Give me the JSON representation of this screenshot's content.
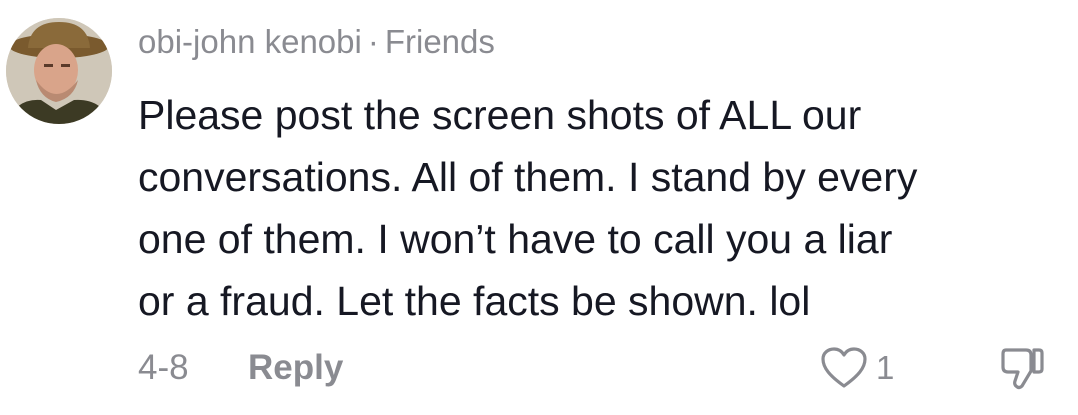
{
  "comment": {
    "author": "obi-john kenobi",
    "separator": "·",
    "relation": "Friends",
    "lines": [
      "Please post the screen shots of ALL our",
      "conversations. All of them. I stand by every",
      "one of them. I won’t have to call you a liar",
      "or a fraud. Let the facts be shown. lol"
    ],
    "date": "4-8",
    "reply_label": "Reply",
    "like_count": "1",
    "like_icon": "heart-outline-icon",
    "dislike_icon": "thumbs-down-icon"
  },
  "colors": {
    "text": "#161823",
    "meta": "#8a8b91",
    "background": "#ffffff"
  }
}
